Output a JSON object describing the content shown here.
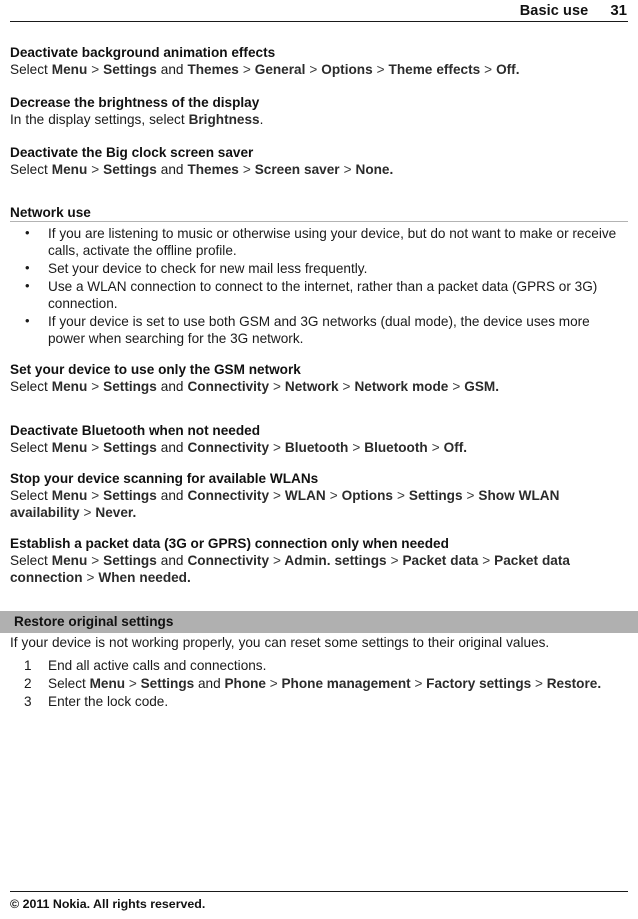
{
  "header": {
    "section_title": "Basic use",
    "page_number": "31"
  },
  "sections": [
    {
      "heading": "Deactivate background animation effects",
      "path_prefix": "Select ",
      "path": "Menu  > Settings and Themes  > General  > Options  > Theme effects  > Off."
    },
    {
      "heading": "Decrease the brightness of the display",
      "body_plain": "In the display settings, select ",
      "body_bold": "Brightness",
      "body_tail": "."
    },
    {
      "heading": "Deactivate the Big clock screen saver",
      "path_prefix": "Select ",
      "path": "Menu  > Settings and Themes  > Screen saver  > None."
    }
  ],
  "network_use": {
    "heading": "Network use",
    "bullets": [
      "If you are listening to music or otherwise using your device, but do not want to make or receive calls, activate the offline profile.",
      "Set your device to check for new mail less frequently.",
      "Use a WLAN connection to connect to the internet, rather than a packet data (GPRS or 3G) connection.",
      "If your device is set to use both GSM and 3G networks (dual mode), the device uses more power when searching for the 3G network."
    ]
  },
  "sections2": [
    {
      "heading": "Set your device to use only the GSM network",
      "path_prefix": "Select ",
      "path": "Menu  > Settings and Connectivity  > Network  > Network mode  > GSM."
    },
    {
      "heading": "Deactivate Bluetooth when not needed",
      "path_prefix": "Select ",
      "path": "Menu  > Settings and Connectivity  > Bluetooth  > Bluetooth  > Off."
    },
    {
      "heading": "Stop your device scanning for available WLANs",
      "path_prefix": "Select ",
      "path": "Menu  > Settings and Connectivity  > WLAN  > Options  > Settings  > Show WLAN availability  > Never."
    },
    {
      "heading": "Establish a packet data (3G or GPRS) connection only when needed",
      "path_prefix": "Select ",
      "path": "Menu  > Settings and Connectivity  > Admin. settings  > Packet data  > Packet data connection  > When needed."
    }
  ],
  "restore": {
    "banner": "Restore original settings",
    "intro": "If your device is not working properly, you can reset some settings to their original values.",
    "steps": [
      {
        "text": "End all active calls and connections."
      },
      {
        "prefix": "Select ",
        "path": "Menu  > Settings and Phone  > Phone management  > Factory settings  > Restore."
      },
      {
        "text": "Enter the lock code."
      }
    ]
  },
  "footer": {
    "copyright": "© 2011 Nokia. All rights reserved."
  }
}
